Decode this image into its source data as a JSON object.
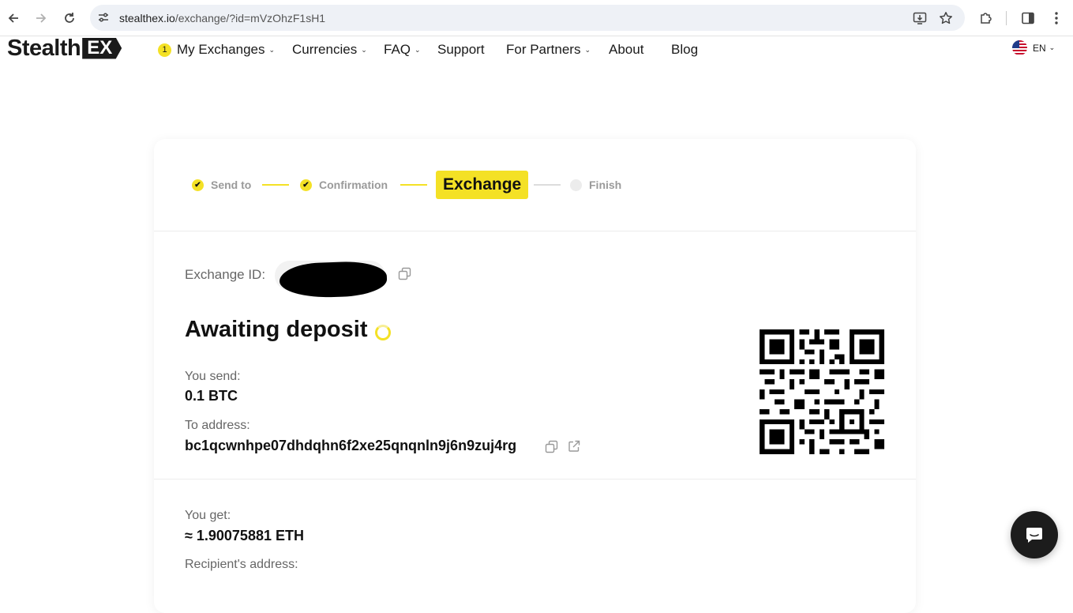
{
  "browser": {
    "url_host": "stealthex.io",
    "url_path": "/exchange/?id=mVzOhzF1sH1",
    "icons": [
      "back-arrow-icon",
      "forward-arrow-icon",
      "reload-icon",
      "site-info-icon",
      "install-app-icon",
      "bookmark-star-icon",
      "extensions-icon",
      "side-panel-icon",
      "menu-dots-icon"
    ]
  },
  "header": {
    "logo_word": "Stealth",
    "logo_ex": "EX",
    "nav": {
      "my_exchanges_badge": "1",
      "my_exchanges": "My Exchanges",
      "currencies": "Currencies",
      "faq": "FAQ",
      "support": "Support",
      "for_partners": "For Partners",
      "about": "About",
      "blog": "Blog"
    },
    "language": "EN"
  },
  "steps": {
    "send_to": "Send to",
    "confirmation": "Confirmation",
    "exchange": "Exchange",
    "finish": "Finish"
  },
  "exchange": {
    "id_label": "Exchange ID:",
    "status": "Awaiting deposit",
    "you_send_label": "You send:",
    "you_send_value": "0.1 BTC",
    "to_address_label": "To address:",
    "to_address_value": "bc1qcwnhpe07dhdqhn6f2xe25qnqnln9j6n9zuj4rg",
    "you_get_label": "You get:",
    "you_get_value": "≈ 1.90075881 ETH",
    "recipient_label": "Recipient's address:"
  },
  "colors": {
    "accent": "#f4e125",
    "text": "#111111",
    "muted": "#666666",
    "fab": "#1c1c1c"
  }
}
